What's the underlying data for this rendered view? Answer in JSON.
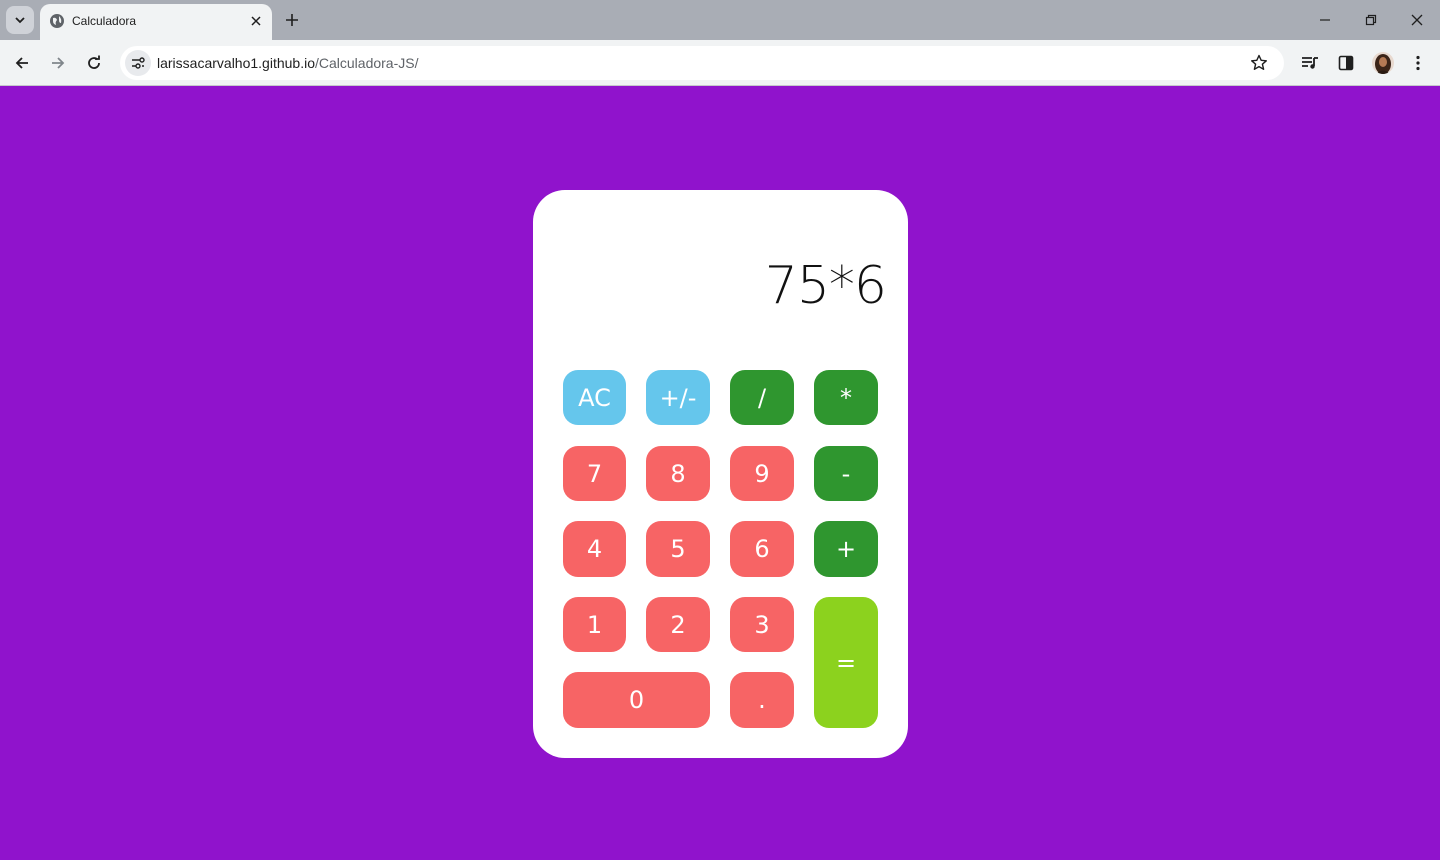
{
  "browser": {
    "tab_title": "Calculadora",
    "url_host": "larissacarvalho1.github.io",
    "url_path": "/Calculadora-JS/"
  },
  "calculator": {
    "display": "75*6",
    "keys": {
      "ac": "AC",
      "sign": "+/-",
      "divide": "/",
      "multiply": "*",
      "seven": "7",
      "eight": "8",
      "nine": "9",
      "minus": "-",
      "four": "4",
      "five": "5",
      "six": "6",
      "plus": "+",
      "one": "1",
      "two": "2",
      "three": "3",
      "equals": "=",
      "zero": "0",
      "decimal": "."
    }
  },
  "colors": {
    "page_background": "#9013cc",
    "function_key": "#65c6ec",
    "operator_key": "#2f962f",
    "number_key": "#f76465",
    "equals_key": "#8cd21e"
  },
  "icons": [
    "tab-search-icon",
    "globe-icon",
    "close-icon",
    "plus-icon",
    "minimize-icon",
    "restore-icon",
    "back-arrow-icon",
    "forward-arrow-icon",
    "reload-icon",
    "site-settings-icon",
    "star-icon",
    "media-controls-icon",
    "side-panel-icon",
    "more-menu-icon"
  ]
}
